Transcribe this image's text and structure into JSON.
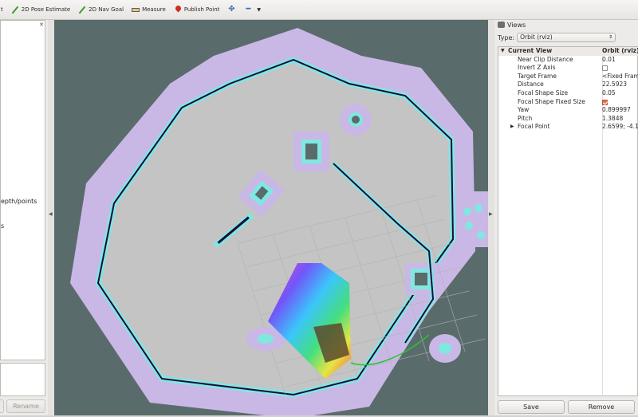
{
  "toolbar": {
    "items": [
      {
        "label": "t"
      },
      {
        "label": "2D Pose Estimate"
      },
      {
        "label": "2D Nav Goal"
      },
      {
        "label": "Measure"
      },
      {
        "label": "Publish Point"
      }
    ],
    "accent": "#3a9a2c"
  },
  "left_panel": {
    "fragment_1": "epth/points",
    "fragment_2": "s",
    "rename_label": "Rename"
  },
  "views": {
    "title": "Views",
    "type_label": "Type:",
    "type_value": "Orbit (rviz)",
    "properties": [
      {
        "name": "Current View",
        "value": "Orbit (rviz)"
      },
      {
        "name": "Near Clip Distance",
        "value": "0.01"
      },
      {
        "name": "Invert Z Axis",
        "value": ""
      },
      {
        "name": "Target Frame",
        "value": "<Fixed Fram"
      },
      {
        "name": "Distance",
        "value": "22.5923"
      },
      {
        "name": "Focal Shape Size",
        "value": "0.05"
      },
      {
        "name": "Focal Shape Fixed Size",
        "value": ""
      },
      {
        "name": "Yaw",
        "value": "0.899997"
      },
      {
        "name": "Pitch",
        "value": "1.3848"
      },
      {
        "name": "Focal Point",
        "value": "2.6599; -4.1"
      }
    ],
    "save_label": "Save",
    "remove_label": "Remove"
  },
  "map_colors": {
    "background": "#5a6b6b",
    "free": "#c7c7c7",
    "inflation": "#c9b8e6",
    "obstacle_edge": "#7fe8e0",
    "occupied": "#1d0b3e",
    "path": "#2fbf3a"
  }
}
